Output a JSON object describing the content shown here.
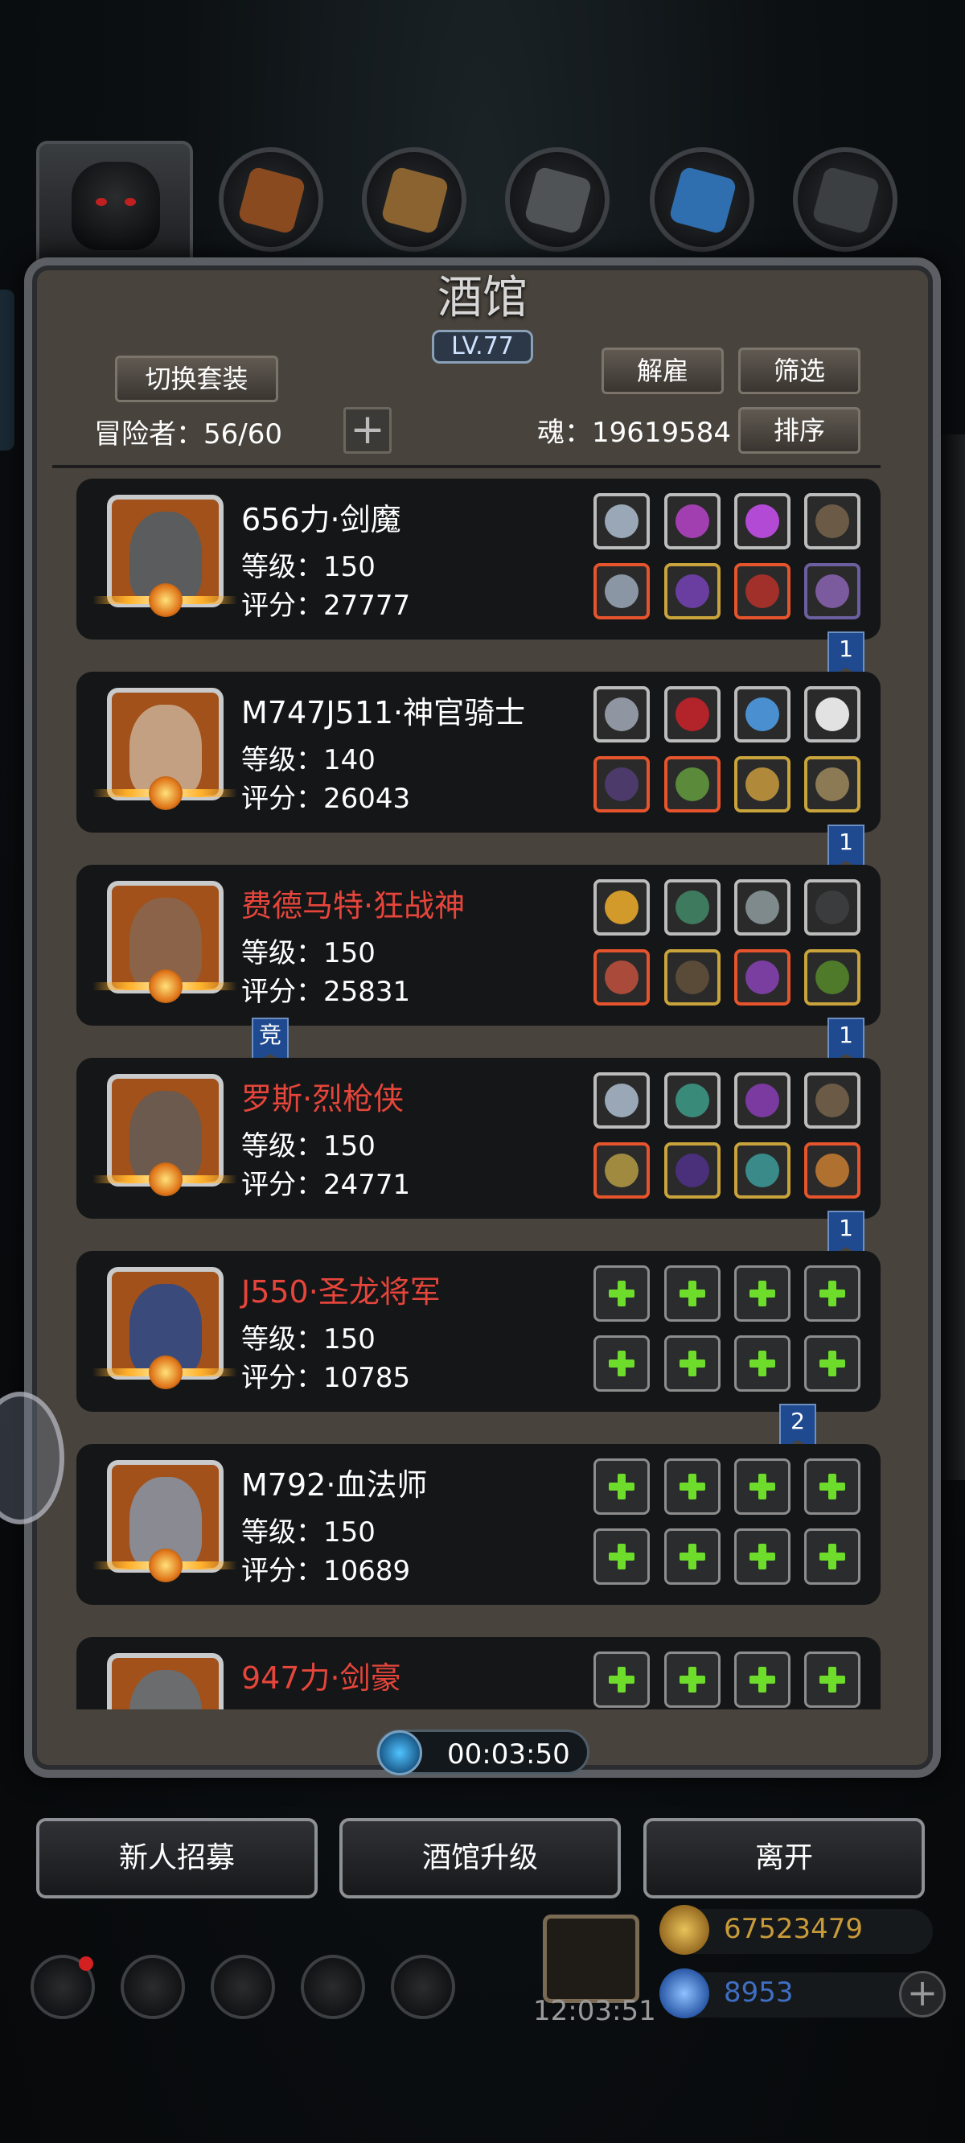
{
  "header": {
    "title": "酒馆",
    "level": "LV.77",
    "switch_outfit": "切换套装",
    "dismiss": "解雇",
    "filter": "筛选",
    "sort": "排序",
    "adventurers_label": "冒险者：56/60",
    "soul_label": "魂：19619584",
    "add_slot_icon": "plus-icon"
  },
  "roster": [
    {
      "name": "656力·剑魔",
      "name_color": "#ffffff",
      "level": "等级：150",
      "score": "评分：27777",
      "flag": "1",
      "badge": ""
    },
    {
      "name": "M747J511·神官骑士",
      "name_color": "#ffffff",
      "level": "等级：140",
      "score": "评分：26043",
      "flag": "1",
      "badge": ""
    },
    {
      "name": "费德马特·狂战神",
      "name_color": "#e5453b",
      "level": "等级：150",
      "score": "评分：25831",
      "flag": "1",
      "badge": "竞"
    },
    {
      "name": "罗斯·烈枪侠",
      "name_color": "#e5453b",
      "level": "等级：150",
      "score": "评分：24771",
      "flag": "1",
      "badge": ""
    },
    {
      "name": "J550·圣龙将军",
      "name_color": "#e5453b",
      "level": "等级：150",
      "score": "评分：10785",
      "flag": "2",
      "badge": ""
    },
    {
      "name": "M792·血法师",
      "name_color": "#ffffff",
      "level": "等级：150",
      "score": "评分：10689",
      "flag": "",
      "badge": ""
    },
    {
      "name": "947力·剑豪",
      "name_color": "#e5453b",
      "level": "",
      "score": "",
      "flag": "",
      "badge": ""
    }
  ],
  "timer": {
    "value": "00:03:50"
  },
  "actions": {
    "recruit": "新人招募",
    "upgrade": "酒馆升级",
    "leave": "离开"
  },
  "footer": {
    "gift_time": "12:03:51",
    "gold": "67523479",
    "gems": "8953"
  },
  "colors": {
    "name_red": "#e5453b",
    "gold_text": "#c89a3a",
    "gem_text": "#3f6fc4"
  }
}
